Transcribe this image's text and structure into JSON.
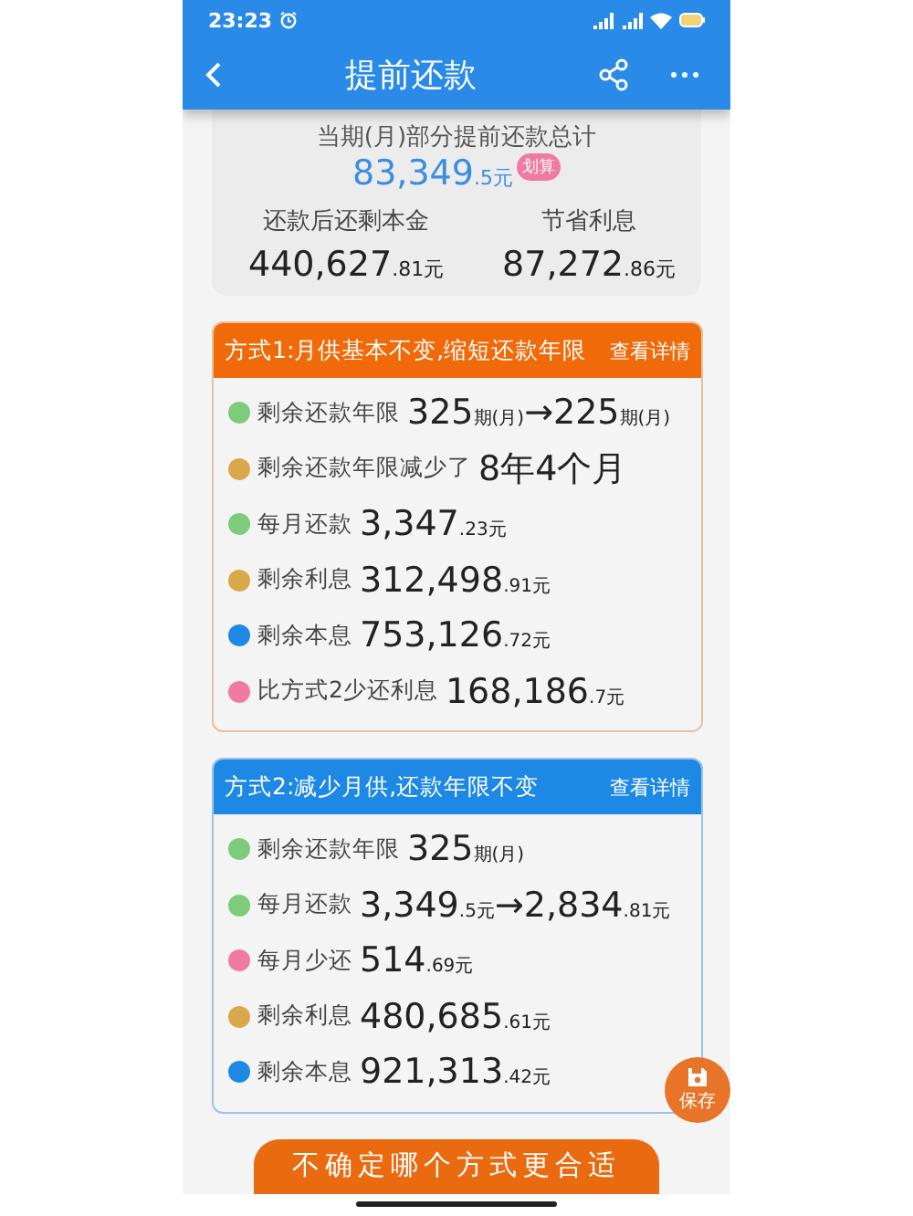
{
  "status_bar": {
    "time": "23:23"
  },
  "header": {
    "title": "提前还款"
  },
  "summary": {
    "label": "当期(月)部分提前还款总计",
    "amount": [
      {
        "text": "83,349",
        "kind": "large"
      },
      {
        "text": ".5元",
        "kind": "small"
      }
    ],
    "badge": "划算",
    "stats": [
      {
        "label": "还款后还剩本金",
        "value": [
          {
            "text": "440,627",
            "kind": "large"
          },
          {
            "text": ".81元",
            "kind": "small"
          }
        ]
      },
      {
        "label": "节省利息",
        "value": [
          {
            "text": "87,272",
            "kind": "large"
          },
          {
            "text": ".86元",
            "kind": "small"
          }
        ]
      }
    ]
  },
  "plans": [
    {
      "title": "方式1:月供基本不变,缩短还款年限",
      "link": "查看详情",
      "color": "#f06a0a",
      "rows": [
        {
          "label": "剩余还款年限",
          "color": "#7dcc7a",
          "value": [
            {
              "text": "325",
              "kind": "large"
            },
            {
              "text": "期(月)",
              "kind": "small"
            },
            {
              "text": "→225",
              "kind": "large"
            },
            {
              "text": "期(月)",
              "kind": "small"
            }
          ]
        },
        {
          "label": "剩余还款年限减少了",
          "color": "#d9a84a",
          "value": [
            {
              "text": "8年4个月",
              "kind": "large"
            }
          ]
        },
        {
          "label": "每月还款",
          "color": "#7dcc7a",
          "value": [
            {
              "text": "3,347",
              "kind": "large"
            },
            {
              "text": ".23元",
              "kind": "small"
            }
          ]
        },
        {
          "label": "剩余利息",
          "color": "#d9a84a",
          "value": [
            {
              "text": "312,498",
              "kind": "large"
            },
            {
              "text": ".91元",
              "kind": "small"
            }
          ]
        },
        {
          "label": "剩余本息",
          "color": "#1e88e5",
          "value": [
            {
              "text": "753,126",
              "kind": "large"
            },
            {
              "text": ".72元",
              "kind": "small"
            }
          ]
        },
        {
          "label": "比方式2少还利息",
          "color": "#f07aa0",
          "value": [
            {
              "text": "168,186",
              "kind": "large"
            },
            {
              "text": ".7元",
              "kind": "small"
            }
          ]
        }
      ]
    },
    {
      "title": "方式2:减少月供,还款年限不变",
      "link": "查看详情",
      "color": "#1e88e5",
      "rows": [
        {
          "label": "剩余还款年限",
          "color": "#7dcc7a",
          "value": [
            {
              "text": "325",
              "kind": "large"
            },
            {
              "text": "期(月)",
              "kind": "small"
            }
          ]
        },
        {
          "label": "每月还款",
          "color": "#7dcc7a",
          "value": [
            {
              "text": "3,349",
              "kind": "large"
            },
            {
              "text": ".5元",
              "kind": "small"
            },
            {
              "text": "→2,834",
              "kind": "large"
            },
            {
              "text": ".81元",
              "kind": "small"
            }
          ]
        },
        {
          "label": "每月少还",
          "color": "#f07aa0",
          "value": [
            {
              "text": "514",
              "kind": "large"
            },
            {
              "text": ".69元",
              "kind": "small"
            }
          ]
        },
        {
          "label": "剩余利息",
          "color": "#d9a84a",
          "value": [
            {
              "text": "480,685",
              "kind": "large"
            },
            {
              "text": ".61元",
              "kind": "small"
            }
          ]
        },
        {
          "label": "剩余本息",
          "color": "#1e88e5",
          "value": [
            {
              "text": "921,313",
              "kind": "large"
            },
            {
              "text": ".42元",
              "kind": "small"
            }
          ]
        }
      ]
    }
  ],
  "save_button": {
    "label": "保存"
  },
  "bottom_button": {
    "label": "不确定哪个方式更合适"
  }
}
